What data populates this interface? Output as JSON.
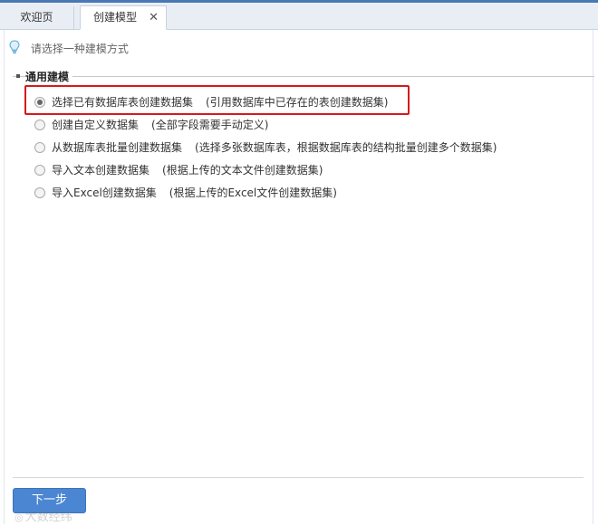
{
  "tabs": [
    {
      "label": "欢迎页"
    },
    {
      "label": "创建模型",
      "close": "✕"
    }
  ],
  "hint": {
    "text": "请选择一种建模方式",
    "icon": "lightbulb-icon"
  },
  "section": {
    "title": "通用建模"
  },
  "options": [
    {
      "label": "选择已有数据库表创建数据集",
      "desc": "(引用数据库中已存在的表创建数据集)",
      "selected": true
    },
    {
      "label": "创建自定义数据集",
      "desc": "(全部字段需要手动定义)",
      "selected": false
    },
    {
      "label": "从数据库表批量创建数据集",
      "desc": "(选择多张数据库表，根据数据库表的结构批量创建多个数据集)",
      "selected": false
    },
    {
      "label": "导入文本创建数据集",
      "desc": "(根据上传的文本文件创建数据集)",
      "selected": false
    },
    {
      "label": "导入Excel创建数据集",
      "desc": "(根据上传的Excel文件创建数据集)",
      "selected": false
    }
  ],
  "footer": {
    "next_label": "下一步"
  },
  "watermark": {
    "text": "大数经纬"
  },
  "colors": {
    "accent": "#4b86d3",
    "highlight": "#d71a1a"
  }
}
